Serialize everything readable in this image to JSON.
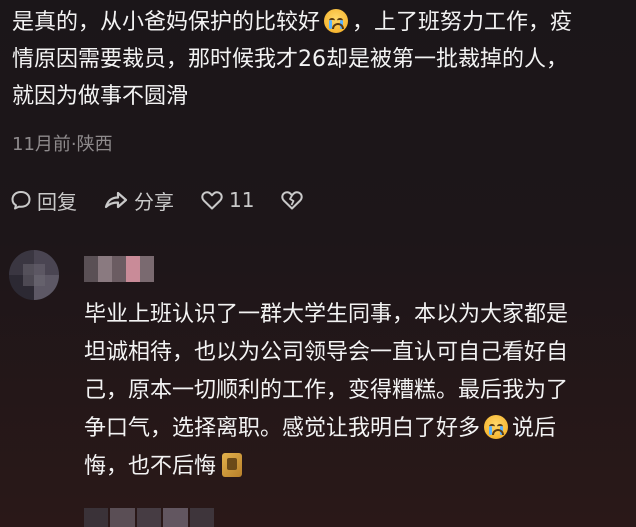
{
  "comment": {
    "line1_a": "是真的，从小爸妈保护的比较好",
    "line1_b": "，上了班努力工作，疫",
    "line2": "情原因需要裁员，那时候我才26却是被第一批裁掉的人，",
    "line3": "就因为做事不圆滑",
    "emoji": "crying-emoji",
    "meta": "11月前·陕西"
  },
  "actions": {
    "reply_label": "回复",
    "share_label": "分享",
    "like_count": "11"
  },
  "reply": {
    "line1": "毕业上班认识了一群大学生同事，本以为大家都是",
    "line2": "坦诚相待，也以为公司领导会一直认可自己看好自",
    "line3": "己，原本一切顺利的工作，变得糟糕。最后我为了",
    "line4_a": "争口气，选择离职。感觉让我明白了好多",
    "line4_b": "说后",
    "line5": "悔，也不后悔",
    "emoji": "crying-emoji",
    "end_emoji": "gold-sticker-emoji"
  },
  "colors": {
    "background": "#19141a",
    "text": "#f3f3f3",
    "meta": "#8e8a8c",
    "icon": "#c9c9c9"
  }
}
